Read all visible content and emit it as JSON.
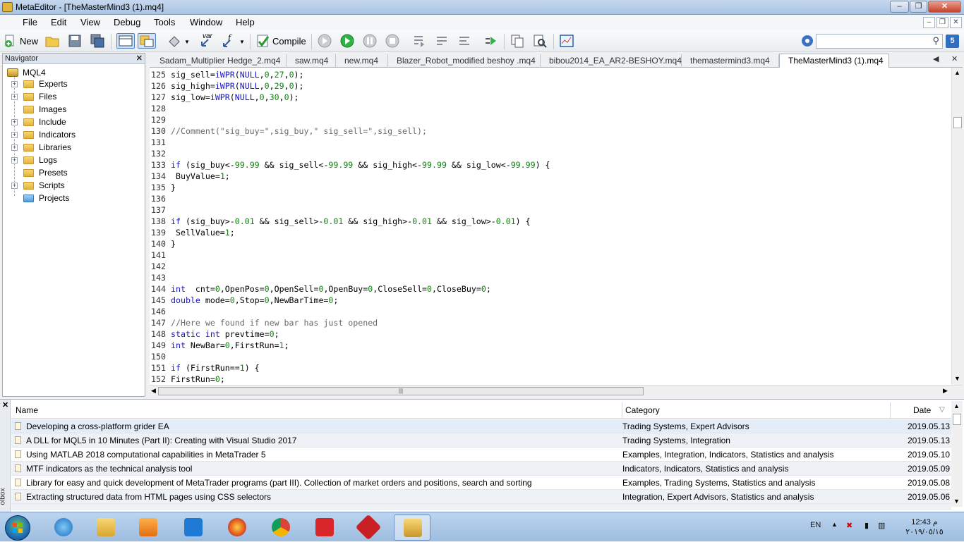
{
  "window": {
    "title": "MetaEditor - [TheMasterMind3 (1).mq4]"
  },
  "menu": [
    "File",
    "Edit",
    "View",
    "Debug",
    "Tools",
    "Window",
    "Help"
  ],
  "toolbar": {
    "new_label": "New",
    "compile_label": "Compile",
    "var_label": "var",
    "search_placeholder": "",
    "badge": "5"
  },
  "navigator": {
    "title": "Navigator",
    "root": "MQL4",
    "items": [
      "Experts",
      "Files",
      "Images",
      "Include",
      "Indicators",
      "Libraries",
      "Logs",
      "Presets",
      "Scripts",
      "Projects"
    ]
  },
  "tabs": [
    "Sadam_Multiplier Hedge_2.mq4",
    "saw.mq4",
    "new.mq4",
    "Blazer_Robot_modified beshoy .mq4",
    "bibou2014_EA_AR2-BESHOY.mq4",
    "themastermind3.mq4",
    "TheMasterMind3 (1).mq4"
  ],
  "code": [
    {
      "n": "125",
      "t": "sig_sell=iWPR(NULL,0,27,0);"
    },
    {
      "n": "126",
      "t": "sig_high=iWPR(NULL,0,29,0);"
    },
    {
      "n": "127",
      "t": "sig_low=iWPR(NULL,0,30,0);"
    },
    {
      "n": "128",
      "t": ""
    },
    {
      "n": "129",
      "t": ""
    },
    {
      "n": "130",
      "t": "//Comment(\"sig_buy=\",sig_buy,\" sig_sell=\",sig_sell);"
    },
    {
      "n": "131",
      "t": ""
    },
    {
      "n": "132",
      "t": ""
    },
    {
      "n": "133",
      "t": "if (sig_buy<-99.99 && sig_sell<-99.99 && sig_high<-99.99 && sig_low<-99.99) {"
    },
    {
      "n": "134",
      "t": " BuyValue=1;"
    },
    {
      "n": "135",
      "t": "}"
    },
    {
      "n": "136",
      "t": ""
    },
    {
      "n": "137",
      "t": ""
    },
    {
      "n": "138",
      "t": "if (sig_buy>-0.01 && sig_sell>-0.01 && sig_high>-0.01 && sig_low>-0.01) {"
    },
    {
      "n": "139",
      "t": " SellValue=1;"
    },
    {
      "n": "140",
      "t": "}"
    },
    {
      "n": "141",
      "t": ""
    },
    {
      "n": "142",
      "t": ""
    },
    {
      "n": "143",
      "t": ""
    },
    {
      "n": "144",
      "t": "int  cnt=0,OpenPos=0,OpenSell=0,OpenBuy=0,CloseSell=0,CloseBuy=0;"
    },
    {
      "n": "145",
      "t": "double mode=0,Stop=0,NewBarTime=0;"
    },
    {
      "n": "146",
      "t": ""
    },
    {
      "n": "147",
      "t": "//Here we found if new bar has just opened"
    },
    {
      "n": "148",
      "t": "static int prevtime=0;"
    },
    {
      "n": "149",
      "t": "int NewBar=0,FirstRun=1;"
    },
    {
      "n": "150",
      "t": ""
    },
    {
      "n": "151",
      "t": "if (FirstRun==1) {"
    },
    {
      "n": "152",
      "t": "FirstRun=0;"
    }
  ],
  "articles": {
    "columns": [
      "Name",
      "Category",
      "Date"
    ],
    "rows": [
      {
        "name": "Developing a cross-platform grider EA",
        "category": "Trading Systems, Expert Advisors",
        "date": "2019.05.13"
      },
      {
        "name": "A DLL for MQL5 in 10 Minutes (Part II): Creating with Visual Studio 2017",
        "category": "Trading Systems, Integration",
        "date": "2019.05.13"
      },
      {
        "name": "Using MATLAB 2018 computational capabilities in MetaTrader 5",
        "category": "Examples, Integration, Indicators, Statistics and analysis",
        "date": "2019.05.10"
      },
      {
        "name": "MTF indicators as the technical analysis tool",
        "category": "Indicators, Indicators, Statistics and analysis",
        "date": "2019.05.09"
      },
      {
        "name": "Library for easy and quick development of MetaTrader programs (part III). Collection of market orders and positions, search and sorting",
        "category": "Examples, Trading Systems, Statistics and analysis",
        "date": "2019.05.08"
      },
      {
        "name": "Extracting structured data from HTML pages using CSS selectors",
        "category": "Integration, Expert Advisors, Statistics and analysis",
        "date": "2019.05.06"
      }
    ],
    "side_label": "olbox"
  },
  "taskbar": {
    "lang": "EN",
    "time": "12:43 م",
    "date": "٢٠١٩/٠٥/١٥"
  },
  "colors": {
    "keyword": "#1717c2",
    "number": "#118111",
    "comment": "#6a6a6a",
    "taskbar": "#9dbde0"
  }
}
